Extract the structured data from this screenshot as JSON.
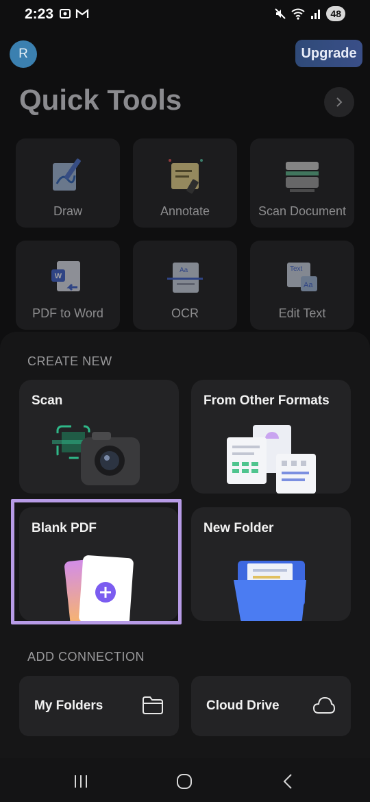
{
  "status_bar": {
    "time": "2:23",
    "battery": "48",
    "icons": [
      "screen-record-icon",
      "gmail-icon",
      "mute-icon",
      "wifi-icon",
      "signal-icon"
    ]
  },
  "header": {
    "avatar_initial": "R",
    "upgrade_label": "Upgrade",
    "title": "Quick Tools"
  },
  "quick_tools": [
    {
      "label": "Draw",
      "icon": "draw-icon"
    },
    {
      "label": "Annotate",
      "icon": "annotate-icon"
    },
    {
      "label": "Scan Document",
      "icon": "scanner-icon"
    },
    {
      "label": "PDF to Word",
      "icon": "pdf-to-word-icon"
    },
    {
      "label": "OCR",
      "icon": "ocr-icon"
    },
    {
      "label": "Edit Text",
      "icon": "edit-text-icon"
    }
  ],
  "create_new": {
    "section_title": "CREATE NEW",
    "cards": [
      {
        "label": "Scan",
        "icon": "camera-icon"
      },
      {
        "label": "From Other Formats",
        "icon": "documents-icon"
      },
      {
        "label": "Blank PDF",
        "icon": "blank-pdf-icon"
      },
      {
        "label": "New Folder",
        "icon": "folder-icon"
      }
    ]
  },
  "add_connection": {
    "section_title": "ADD CONNECTION",
    "items": [
      {
        "label": "My Folders",
        "icon": "folder-outline-icon"
      },
      {
        "label": "Cloud Drive",
        "icon": "cloud-icon"
      }
    ]
  },
  "colors": {
    "background": "#0f0f10",
    "card": "#232325",
    "highlight": "#b79be6",
    "accent_purple": "#7b5cf0",
    "upgrade": "#3a4f88"
  }
}
